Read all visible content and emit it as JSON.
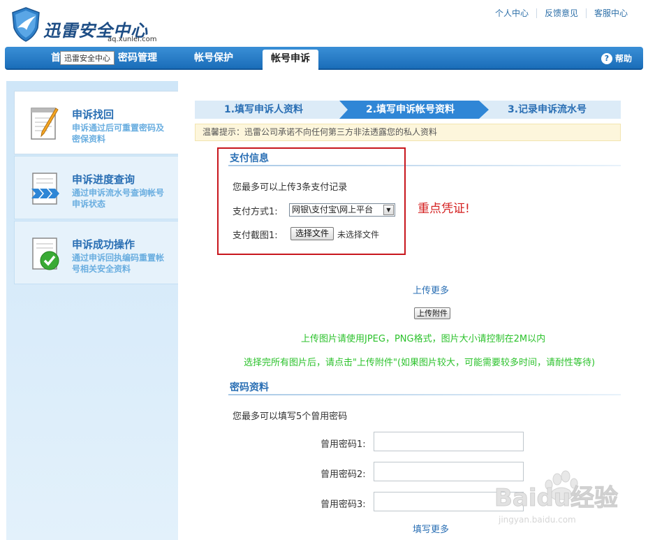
{
  "header": {
    "logo_text": "迅雷安全中心",
    "logo_domain": "aq.xunlei.com",
    "links": [
      "个人中心",
      "反馈意见",
      "客服中心"
    ]
  },
  "nav": {
    "items": [
      "首",
      "密码管理",
      "帐号保护",
      "帐号申诉"
    ],
    "active_index": 3,
    "tooltip": "迅雷安全中心",
    "help": "帮助"
  },
  "sidebar": {
    "items": [
      {
        "title": "申诉找回",
        "desc": "申诉通过后可重置密码及密保资料",
        "icon": "notepad-pencil-icon"
      },
      {
        "title": "申诉进度查询",
        "desc": "通过申诉流水号查询帐号申诉状态",
        "icon": "document-arrows-icon"
      },
      {
        "title": "申诉成功操作",
        "desc": "通过申诉回执编码重置帐号相关安全资料",
        "icon": "document-check-icon"
      }
    ]
  },
  "steps": [
    "1.填写申诉人资料",
    "2.填写申诉帐号资料",
    "3.记录申诉流水号"
  ],
  "tip": "温馨提示：迅雷公司承诺不向任何第三方非法透露您的私人资料",
  "payment": {
    "title": "支付信息",
    "intro": "您最多可以上传3条支付记录",
    "method_label": "支付方式1:",
    "method_value": "网银\\支付宝\\网上平台",
    "screenshot_label": "支付截图1:",
    "choose_file": "选择文件",
    "no_file": "未选择文件",
    "note": "重点凭证!"
  },
  "upload": {
    "more": "上传更多",
    "button": "上传附件",
    "hint1": "上传图片请使用JPEG，PNG格式，图片大小请控制在2M以内",
    "hint2": "选择完所有图片后，请点击\"上传附件\"(如果图片较大，可能需要较多时间，请耐性等待)"
  },
  "password": {
    "title": "密码资料",
    "intro": "您最多可以填写5个曾用密码",
    "fields": [
      "曾用密码1:",
      "曾用密码2:",
      "曾用密码3:"
    ],
    "more": "填写更多"
  },
  "watermark": {
    "text": "Baidu经验",
    "sub": "jingyan.baidu.com"
  },
  "colors": {
    "nav_blue": "#1a6db9",
    "link_blue": "#2a6fb4",
    "alert_red": "#c8161d",
    "hint_green": "#2cc22c"
  }
}
